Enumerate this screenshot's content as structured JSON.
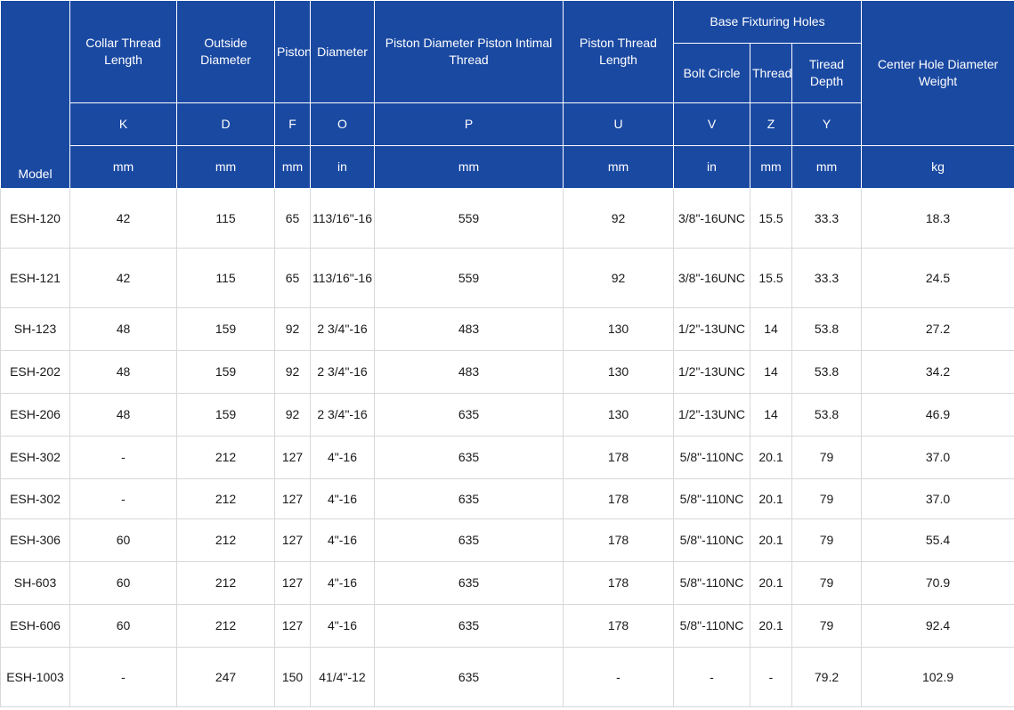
{
  "header": {
    "model": "Model",
    "groups": {
      "collar": "Collar Thread Length",
      "outside": "Outside Diameter",
      "piston": "Piston",
      "diameter": "Diameter",
      "intimal": "Piston Diameter Piston Intimal Thread",
      "thread_length": "Piston Thread Length",
      "base": "Base Fixturing Holes",
      "bolt": "Bolt Circle",
      "thread": "Thread",
      "tiread": "Tiread Depth",
      "center": "Center Hole Diameter Weight"
    },
    "symbols": [
      "K",
      "D",
      "F",
      "O",
      "P",
      "U",
      "V",
      "Z",
      "Y"
    ],
    "units": [
      "mm",
      "mm",
      "mm",
      "in",
      "mm",
      "mm",
      "in",
      "mm",
      "mm",
      "kg"
    ]
  },
  "rows": [
    [
      "ESH-120",
      "42",
      "115",
      "65",
      "113/16\"-16",
      "559",
      "92",
      "3/8\"-16UNC",
      "15.5",
      "33.3",
      "18.3"
    ],
    [
      "ESH-121",
      "42",
      "115",
      "65",
      "113/16\"-16",
      "559",
      "92",
      "3/8\"-16UNC",
      "15.5",
      "33.3",
      "24.5"
    ],
    [
      "SH-123",
      "48",
      "159",
      "92",
      "2 3/4\"-16",
      "483",
      "130",
      "1/2\"-13UNC",
      "14",
      "53.8",
      "27.2"
    ],
    [
      "ESH-202",
      "48",
      "159",
      "92",
      "2 3/4\"-16",
      "483",
      "130",
      "1/2\"-13UNC",
      "14",
      "53.8",
      "34.2"
    ],
    [
      "ESH-206",
      "48",
      "159",
      "92",
      "2 3/4\"-16",
      "635",
      "130",
      "1/2\"-13UNC",
      "14",
      "53.8",
      "46.9"
    ],
    [
      "ESH-302",
      "-",
      "212",
      "127",
      "4\"-16",
      "635",
      "178",
      "5/8\"-110NC",
      "20.1",
      "79",
      "37.0"
    ],
    [
      "ESH-302",
      "-",
      "212",
      "127",
      "4\"-16",
      "635",
      "178",
      "5/8\"-110NC",
      "20.1",
      "79",
      "37.0"
    ],
    [
      "ESH-306",
      "60",
      "212",
      "127",
      "4\"-16",
      "635",
      "178",
      "5/8\"-110NC",
      "20.1",
      "79",
      "55.4"
    ],
    [
      "SH-603",
      "60",
      "212",
      "127",
      "4\"-16",
      "635",
      "178",
      "5/8\"-110NC",
      "20.1",
      "79",
      "70.9"
    ],
    [
      "ESH-606",
      "60",
      "212",
      "127",
      "4\"-16",
      "635",
      "178",
      "5/8\"-110NC",
      "20.1",
      "79",
      "92.4"
    ],
    [
      "ESH-1003",
      "-",
      "247",
      "150",
      "41/4\"-12",
      "635",
      "-",
      "-",
      "-",
      "79.2",
      "102.9"
    ]
  ]
}
